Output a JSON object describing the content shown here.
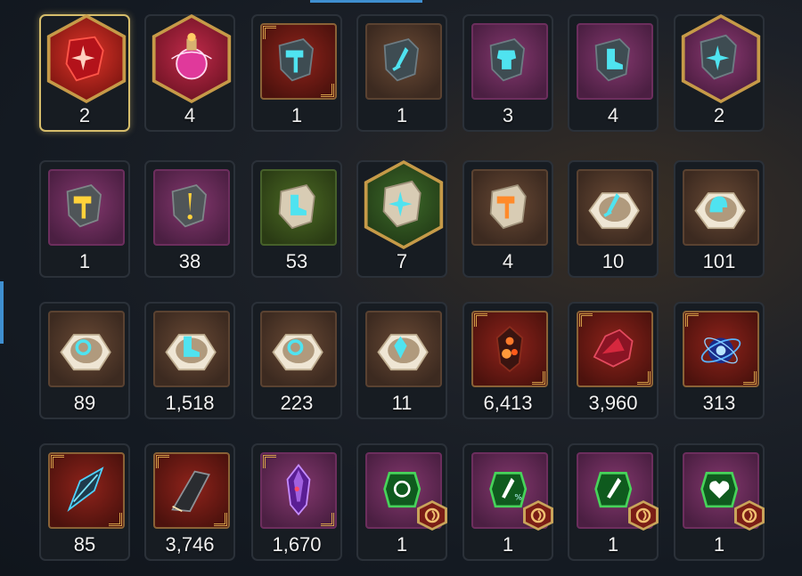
{
  "inventory": {
    "rows": [
      [
        {
          "count": "2",
          "icon": "red-star-rune-icon",
          "frame": "hex",
          "tone": "red",
          "selected": true
        },
        {
          "count": "4",
          "icon": "pink-potion-icon",
          "frame": "hex",
          "tone": "pink"
        },
        {
          "count": "1",
          "icon": "hammer-rune-stone-icon",
          "frame": "square",
          "tone": "darkred",
          "corners": true
        },
        {
          "count": "1",
          "icon": "sword-rune-stone-icon",
          "frame": "square",
          "tone": "brown"
        },
        {
          "count": "3",
          "icon": "armor-rune-stone-icon",
          "frame": "square",
          "tone": "purple"
        },
        {
          "count": "4",
          "icon": "boot-rune-stone-icon",
          "frame": "square",
          "tone": "purple"
        },
        {
          "count": "2",
          "icon": "star-rune-stone-icon",
          "frame": "hex",
          "tone": "purple"
        }
      ],
      [
        {
          "count": "1",
          "icon": "gold-hammer-stone-icon",
          "frame": "square",
          "tone": "purple"
        },
        {
          "count": "38",
          "icon": "gold-blade-stone-icon",
          "frame": "square",
          "tone": "purple"
        },
        {
          "count": "53",
          "icon": "boot-tablet-stone-icon",
          "frame": "square",
          "tone": "green"
        },
        {
          "count": "7",
          "icon": "star-tablet-stone-icon",
          "frame": "hex",
          "tone": "green"
        },
        {
          "count": "4",
          "icon": "hammer-tablet-stone-icon",
          "frame": "square",
          "tone": "brown"
        },
        {
          "count": "10",
          "icon": "sword-scroll-icon",
          "frame": "square",
          "tone": "brown"
        },
        {
          "count": "101",
          "icon": "helmet-scroll-icon",
          "frame": "square",
          "tone": "brown"
        }
      ],
      [
        {
          "count": "89",
          "icon": "ring-scroll-icon",
          "frame": "square",
          "tone": "brown"
        },
        {
          "count": "1,518",
          "icon": "boot-scroll-icon",
          "frame": "square",
          "tone": "brown"
        },
        {
          "count": "223",
          "icon": "necklace-scroll-icon",
          "frame": "square",
          "tone": "brown"
        },
        {
          "count": "11",
          "icon": "gem-scroll-icon",
          "frame": "square",
          "tone": "brown"
        },
        {
          "count": "6,413",
          "icon": "dark-crystal-icon",
          "frame": "square",
          "tone": "darkred",
          "corners": true
        },
        {
          "count": "3,960",
          "icon": "crimson-shard-icon",
          "frame": "square",
          "tone": "darkred",
          "corners": true
        },
        {
          "count": "313",
          "icon": "blue-orb-icon",
          "frame": "square",
          "tone": "darkred",
          "corners": true
        }
      ],
      [
        {
          "count": "85",
          "icon": "blue-claw-shard-icon",
          "frame": "square",
          "tone": "darkred",
          "corners": true
        },
        {
          "count": "3,746",
          "icon": "dark-blade-shard-icon",
          "frame": "square",
          "tone": "darkred",
          "corners": true
        },
        {
          "count": "1,670",
          "icon": "purple-crystal-icon",
          "frame": "square",
          "tone": "purple",
          "corners": true
        },
        {
          "count": "1",
          "icon": "sun-emblem-gem-icon",
          "frame": "square",
          "tone": "purple",
          "badge": true
        },
        {
          "count": "1",
          "icon": "sword-percent-gem-icon",
          "frame": "square",
          "tone": "purple",
          "badge": true
        },
        {
          "count": "1",
          "icon": "sword-emblem-gem-icon",
          "frame": "square",
          "tone": "purple",
          "badge": true
        },
        {
          "count": "1",
          "icon": "heart-percent-gem-icon",
          "frame": "square",
          "tone": "purple",
          "badge": true
        }
      ]
    ]
  }
}
